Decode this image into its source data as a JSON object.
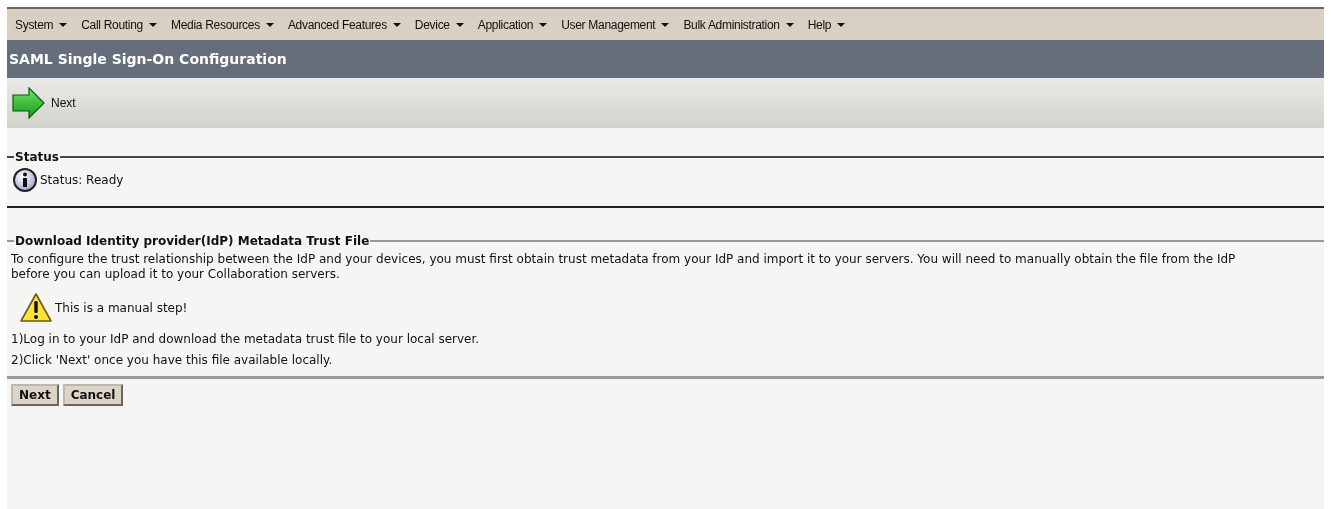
{
  "menu": [
    {
      "label": "System"
    },
    {
      "label": "Call Routing"
    },
    {
      "label": "Media Resources"
    },
    {
      "label": "Advanced Features"
    },
    {
      "label": "Device"
    },
    {
      "label": "Application"
    },
    {
      "label": "User Management"
    },
    {
      "label": "Bulk Administration"
    },
    {
      "label": "Help"
    }
  ],
  "page_title": "SAML Single Sign-On Configuration",
  "toolbar": {
    "next_label": "Next"
  },
  "status": {
    "legend": "Status",
    "text": "Status: Ready"
  },
  "download": {
    "legend": "Download Identity provider(IdP) Metadata Trust File",
    "description": "To configure the trust relationship between the IdP and your devices, you must first obtain trust metadata from your IdP and import it to your servers. You will need to manually obtain the file from the IdP before you can upload it to your Collaboration servers.",
    "warning": "This is a manual step!",
    "steps": [
      "1)Log in to your IdP and download the metadata trust file to your local server.",
      "2)Click 'Next' once you have this file available locally."
    ]
  },
  "buttons": [
    "Next",
    "Cancel"
  ]
}
